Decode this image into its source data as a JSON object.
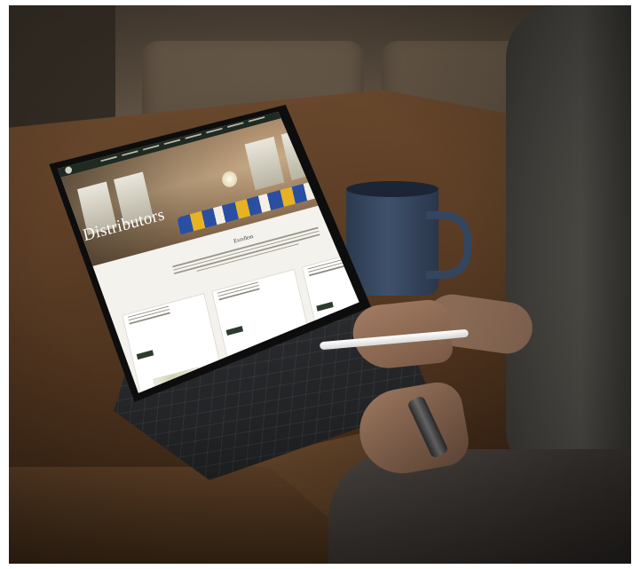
{
  "website": {
    "hero_title": "Distributors",
    "section_title": "Excellent"
  }
}
